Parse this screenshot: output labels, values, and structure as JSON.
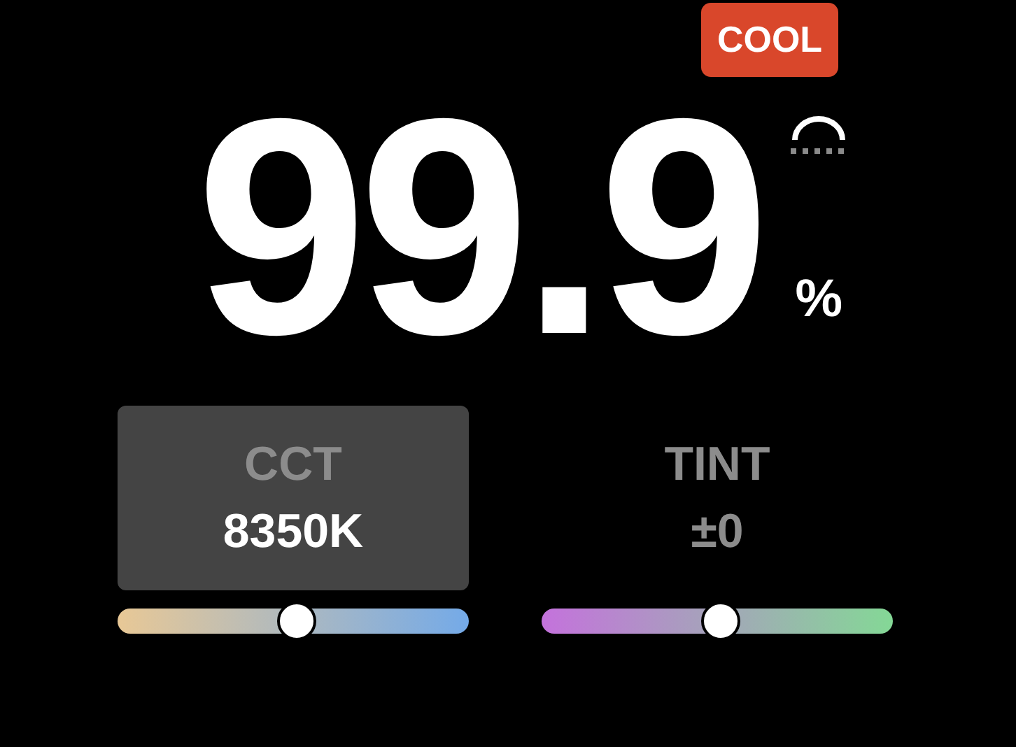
{
  "badge": "COOL",
  "intensity": {
    "value": "99.9",
    "unit": "%"
  },
  "controls": [
    {
      "label": "CCT",
      "value": "8350K",
      "selected": true,
      "level": 0.51,
      "kind": "temperature"
    },
    {
      "label": "TINT",
      "value": "±0",
      "selected": false,
      "level": 0.51,
      "kind": "tint"
    }
  ]
}
